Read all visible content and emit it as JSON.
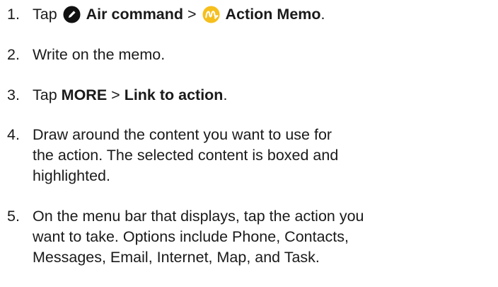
{
  "steps": [
    {
      "number": "1.",
      "parts": {
        "prefix": "Tap",
        "bold1": "Air command",
        "sep": ">",
        "bold2": "Action Memo",
        "end": "."
      },
      "icons": [
        "air-command-icon",
        "action-memo-icon"
      ]
    },
    {
      "number": "2.",
      "text": "Write on the memo."
    },
    {
      "number": "3.",
      "parts": {
        "prefix": "Tap",
        "bold1": "MORE",
        "sep": ">",
        "bold2": "Link to action",
        "end": "."
      }
    },
    {
      "number": "4.",
      "lines": [
        "Draw around the content you want to use for",
        "the action. The selected content is boxed and",
        "highlighted."
      ]
    },
    {
      "number": "5.",
      "lines": [
        "On the menu bar that displays, tap the action you",
        "want to take. Options include Phone, Contacts,",
        "Messages, Email, Internet, Map, and Task."
      ]
    }
  ],
  "colors": {
    "air_command_icon_bg": "#111111",
    "action_memo_icon_bg": "#f5bf1d",
    "text": "#1a1a1a"
  }
}
